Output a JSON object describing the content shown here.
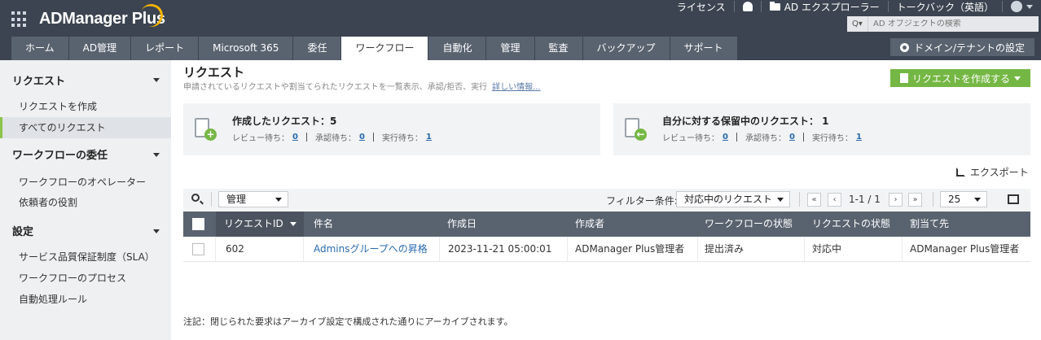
{
  "header": {
    "logo": "ADManager Plus",
    "license": "ライセンス",
    "ad_explorer": "AD エクスプローラー",
    "talkback": "トークバック（英語）",
    "search_placeholder": "AD オブジェクトの検索",
    "domain_button": "ドメイン/テナントの設定"
  },
  "nav": {
    "tabs": [
      {
        "label": "ホーム"
      },
      {
        "label": "AD管理"
      },
      {
        "label": "レポート"
      },
      {
        "label": "Microsoft 365"
      },
      {
        "label": "委任"
      },
      {
        "label": "ワークフロー",
        "active": true
      },
      {
        "label": "自動化"
      },
      {
        "label": "管理"
      },
      {
        "label": "監査"
      },
      {
        "label": "バックアップ"
      },
      {
        "label": "サポート"
      }
    ]
  },
  "sidebar": {
    "section1": "リクエスト",
    "item_create": "リクエストを作成",
    "item_all": "すべてのリクエスト",
    "section2": "ワークフローの委任",
    "item_operator": "ワークフローのオペレーター",
    "item_requester": "依頼者の役割",
    "section3": "設定",
    "item_sla": "サービス品質保証制度（SLA）",
    "item_process": "ワークフローのプロセス",
    "item_auto": "自動処理ルール"
  },
  "main": {
    "title": "リクエスト",
    "subtitle": "申請されているリクエストや割当てられたリクエストを一覧表示、承認/拒否、実行",
    "more_info": "詳しい情報...",
    "create_button": "リクエストを作成する",
    "card1": {
      "title": "作成したリクエスト：5",
      "review_label": "レビュー待ち：",
      "review_value": "0",
      "approve_label": "承認待ち：",
      "approve_value": "0",
      "execute_label": "実行待ち：",
      "execute_value": "1"
    },
    "card2": {
      "title": "自分に対する保留中のリクエスト： 1",
      "review_label": "レビュー待ち：",
      "review_value": "0",
      "approve_label": "承認待ち：",
      "approve_value": "0",
      "execute_label": "実行待ち：",
      "execute_value": "1"
    },
    "export": "エクスポート",
    "toolbar": {
      "view_select": "管理",
      "filter_label": "フィルター条件:",
      "filter_select": "対応中のリクエスト",
      "page_info": "1-1 / 1",
      "page_size": "25"
    },
    "table": {
      "headers": [
        "リクエストID",
        "件名",
        "作成日",
        "作成者",
        "ワークフローの状態",
        "リクエストの状態",
        "割当て先"
      ],
      "rows": [
        {
          "id": "602",
          "subject": "Adminsグループへの昇格",
          "created": "2023-11-21 05:00:01",
          "creator": "ADManager Plus管理者",
          "workflow_state": "提出済み",
          "request_state": "対応中",
          "assignee": "ADManager Plus管理者"
        }
      ]
    },
    "note": "注記：閉じられた要求はアーカイブ設定で構成された通りにアーカイブされます。"
  },
  "colors": {
    "header_bg": "#3b4450",
    "tab_bg": "#59636f",
    "accent_green": "#75b744",
    "link_blue": "#2a6ab0"
  }
}
